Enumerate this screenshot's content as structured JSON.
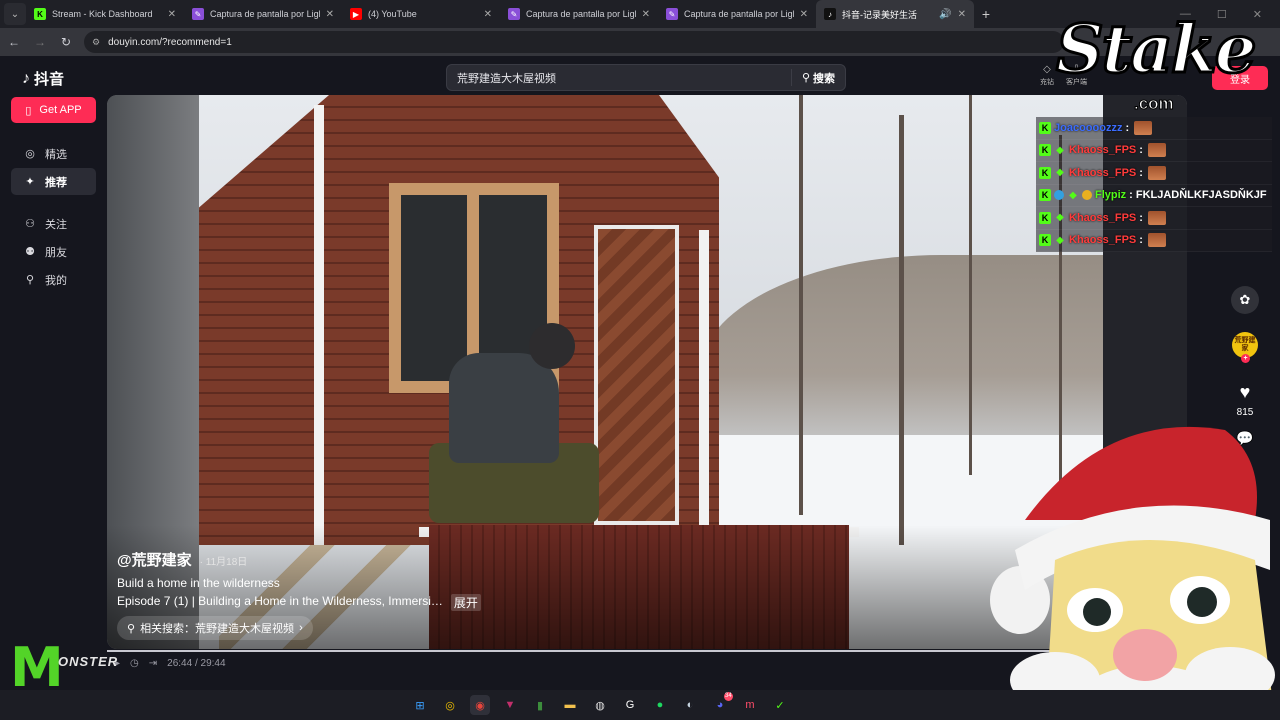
{
  "browser": {
    "tabs": [
      {
        "title": "Stream - Kick Dashboard",
        "icon": "kick-icon",
        "color": "#53fc18",
        "glyph": "K",
        "active": false
      },
      {
        "title": "Captura de pantalla por Lightsh",
        "icon": "lightshot-icon",
        "color": "#8a4fd8",
        "glyph": "✎",
        "active": false
      },
      {
        "title": "(4) YouTube",
        "icon": "youtube-icon",
        "color": "#ff0000",
        "glyph": "▶",
        "active": false
      },
      {
        "title": "Captura de pantalla por Lightsh",
        "icon": "lightshot-icon",
        "color": "#8a4fd8",
        "glyph": "✎",
        "active": false
      },
      {
        "title": "Captura de pantalla por Lightsh",
        "icon": "lightshot-icon",
        "color": "#8a4fd8",
        "glyph": "✎",
        "active": false
      },
      {
        "title": "抖音-记录美好生活",
        "icon": "tiktok-icon",
        "color": "#111111",
        "glyph": "♪",
        "active": true
      }
    ],
    "new_tab": "+",
    "url": "douyin.com/?recommend=1"
  },
  "douyin": {
    "logo_text": "抖音",
    "search_value": "荒野建造大木屋视频",
    "search_button": "搜索",
    "get_app": "Get APP",
    "nav": [
      {
        "label": "精选",
        "icon": "compass-icon",
        "glyph": "◎",
        "active": false
      },
      {
        "label": "推荐",
        "icon": "sparkle-icon",
        "glyph": "✦",
        "active": true
      },
      {
        "label": "关注",
        "icon": "follow-icon",
        "glyph": "⚇",
        "active": false
      },
      {
        "label": "朋友",
        "icon": "friends-icon",
        "glyph": "⚉",
        "active": false
      },
      {
        "label": "我的",
        "icon": "profile-icon",
        "glyph": "⚲",
        "active": false
      }
    ],
    "top_right": [
      {
        "label": "充钻",
        "glyph": "◇"
      },
      {
        "label": "客户端",
        "glyph": "⇩"
      }
    ],
    "login": "登录"
  },
  "video": {
    "author": "@荒野建家",
    "date": "11月18日",
    "desc_line1": "Build a home in the wilderness",
    "desc_line2": "Episode 7 (1) | Building a Home in the Wilderness, Immersi…",
    "expand": "展开",
    "related": "相关搜索：荒野建造大木屋视频",
    "avatar_text": "荒野建家",
    "likes": "815",
    "time": "26:44 / 29:44",
    "progress": 0.899
  },
  "chat": [
    {
      "user": "Joacoooozzz",
      "color": "#3b6cff",
      "badges": [
        "k"
      ],
      "msg": ""
    },
    {
      "user": "Khaoss_FPS",
      "color": "#ff3b3b",
      "badges": [
        "k",
        "g"
      ],
      "msg": ""
    },
    {
      "user": "Khaoss_FPS",
      "color": "#ff3b3b",
      "badges": [
        "k",
        "g"
      ],
      "msg": ""
    },
    {
      "user": "Flypiz",
      "color": "#53fc18",
      "badges": [
        "k",
        "o",
        "g",
        "c"
      ],
      "msg": "FKLJADŇLKFJASDŇKJF"
    },
    {
      "user": "Khaoss_FPS",
      "color": "#ff3b3b",
      "badges": [
        "k",
        "g"
      ],
      "msg": ""
    },
    {
      "user": "Khaoss_FPS",
      "color": "#ff3b3b",
      "badges": [
        "k",
        "g"
      ],
      "msg": ""
    }
  ],
  "overlay": {
    "stake_word": "Stake",
    "stake_com": ".com",
    "monster_text": "ONSTER"
  },
  "taskbar": [
    {
      "name": "windows-start-icon",
      "glyph": "⊞",
      "color": "#3aa0ff"
    },
    {
      "name": "norton-icon",
      "glyph": "◎",
      "color": "#f3c300"
    },
    {
      "name": "chrome-icon",
      "glyph": "◉",
      "color": "#e8453c",
      "active": true
    },
    {
      "name": "vegas-icon",
      "glyph": "▼",
      "color": "#c22f6b"
    },
    {
      "name": "bookmark-app-icon",
      "glyph": "▮",
      "color": "#3c8d3c"
    },
    {
      "name": "file-explorer-icon",
      "glyph": "▬",
      "color": "#f2c14e"
    },
    {
      "name": "obs-icon",
      "glyph": "◍",
      "color": "#dddddd"
    },
    {
      "name": "gg-icon",
      "glyph": "G",
      "color": "#ffffff"
    },
    {
      "name": "spotify-icon",
      "glyph": "●",
      "color": "#1ed760"
    },
    {
      "name": "steam-icon",
      "glyph": "◐",
      "color": "#c7d5e0"
    },
    {
      "name": "discord-icon",
      "glyph": "◕",
      "color": "#5865f2",
      "badge": "34"
    },
    {
      "name": "messenger-app-icon",
      "glyph": "m",
      "color": "#ff4d6a"
    },
    {
      "name": "kick-app-icon",
      "glyph": "✓",
      "color": "#53fc18"
    }
  ]
}
